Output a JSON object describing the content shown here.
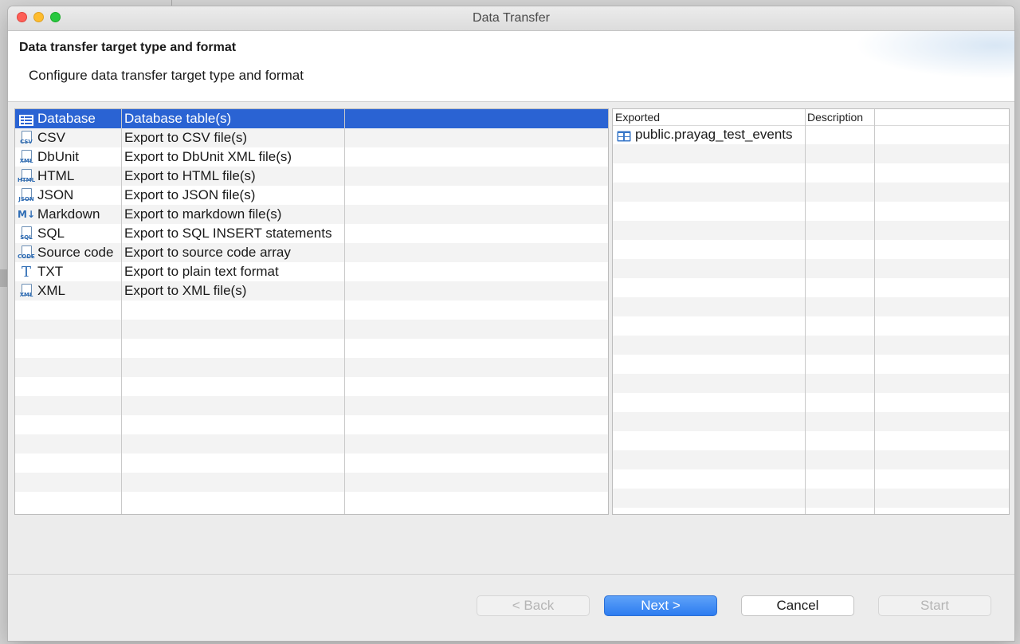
{
  "window": {
    "title": "Data Transfer"
  },
  "page": {
    "title": "Data transfer target type and format",
    "description": "Configure data transfer target type and format"
  },
  "formats": [
    {
      "name": "Database",
      "description": "Database table(s)",
      "icon": "database-icon",
      "icon_text": "",
      "selected": true
    },
    {
      "name": "CSV",
      "description": "Export to CSV file(s)",
      "icon": "csv-file-icon",
      "icon_text": "CSV"
    },
    {
      "name": "DbUnit",
      "description": "Export to DbUnit XML file(s)",
      "icon": "xml-file-icon",
      "icon_text": "XML"
    },
    {
      "name": "HTML",
      "description": "Export to HTML file(s)",
      "icon": "html-file-icon",
      "icon_text": "HTML"
    },
    {
      "name": "JSON",
      "description": "Export to JSON file(s)",
      "icon": "json-file-icon",
      "icon_text": "JSON"
    },
    {
      "name": "Markdown",
      "description": "Export to markdown file(s)",
      "icon": "markdown-icon",
      "icon_text": "M↓"
    },
    {
      "name": "SQL",
      "description": "Export to SQL INSERT statements",
      "icon": "sql-file-icon",
      "icon_text": "SQL"
    },
    {
      "name": "Source code",
      "description": "Export to source code array",
      "icon": "code-file-icon",
      "icon_text": "CODE"
    },
    {
      "name": "TXT",
      "description": "Export to plain text format",
      "icon": "text-icon",
      "icon_text": "T"
    },
    {
      "name": "XML",
      "description": "Export to XML file(s)",
      "icon": "xml-file-icon",
      "icon_text": "XML"
    }
  ],
  "exported_table": {
    "columns": [
      "Exported",
      "Description"
    ],
    "rows": [
      {
        "name": "public.prayag_test_events",
        "description": "",
        "icon": "table-icon"
      }
    ]
  },
  "buttons": {
    "back": "< Back",
    "next": "Next >",
    "cancel": "Cancel",
    "start": "Start"
  }
}
